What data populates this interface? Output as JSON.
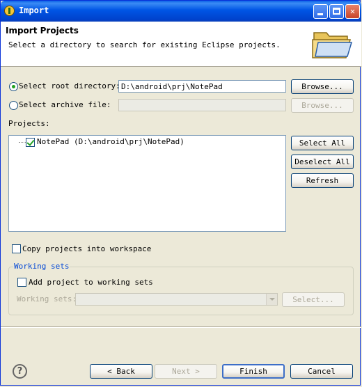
{
  "window": {
    "title": "Import"
  },
  "header": {
    "title": "Import Projects",
    "description": "Select a directory to search for existing Eclipse projects."
  },
  "root": {
    "radio_label": "Select root directory:",
    "value": "D:\\android\\prj\\NotePad",
    "browse_label": "Browse..."
  },
  "archive": {
    "radio_label": "Select archive file:",
    "value": "",
    "browse_label": "Browse..."
  },
  "projects": {
    "label": "Projects:",
    "items": [
      {
        "label": "NotePad (D:\\android\\prj\\NotePad)",
        "checked": true
      }
    ],
    "select_all": "Select All",
    "deselect_all": "Deselect All",
    "refresh": "Refresh"
  },
  "copy_projects": {
    "label": "Copy projects into workspace",
    "checked": false
  },
  "working_sets": {
    "group_label": "Working sets",
    "add_label": "Add project to working sets",
    "field_label": "Working sets:",
    "select_label": "Select..."
  },
  "footer": {
    "help_glyph": "?",
    "back": "< Back",
    "next": "Next >",
    "finish": "Finish",
    "cancel": "Cancel"
  },
  "colors": {
    "titlebar": "#0055e5",
    "accent": "#0046d5",
    "check": "#21a121"
  }
}
